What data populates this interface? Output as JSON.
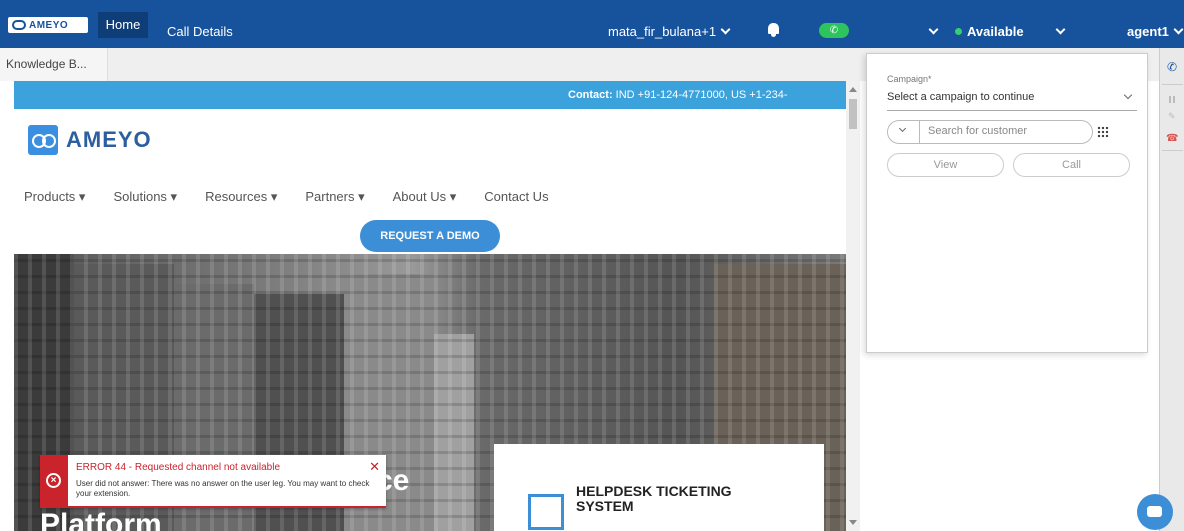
{
  "topbar": {
    "brand": "AMEYO",
    "nav": {
      "home": "Home",
      "call_details": "Call Details"
    },
    "campaign": "mata_fir_bulana+1",
    "status": "Available",
    "agent": "agent1",
    "colors": {
      "bar": "#17529d",
      "available": "#35d06b",
      "phone": "#2ec45d"
    }
  },
  "tabs": {
    "knowledge": "Knowledge B..."
  },
  "website": {
    "contact_label": "Contact:",
    "contact_text": " IND +91-124-4771000, US +1-234-",
    "logo_text": "AMEYO",
    "menu": [
      "Products ▾",
      "Solutions ▾",
      "Resources ▾",
      "Partners ▾",
      "About Us ▾",
      "Contact Us"
    ],
    "demo_button": "REQUEST A DEMO",
    "hero_line1_tail": "ce",
    "hero_line2": "Platform",
    "card_title": "HELPDESK TICKETING SYSTEM"
  },
  "error_toast": {
    "title": "ERROR 44 - Requested channel not available",
    "detail": "User did not answer: There was no answer on the user leg. You may want to check your extension.",
    "close": "✕"
  },
  "dial_panel": {
    "campaign_label": "Campaign*",
    "campaign_select": "Select a campaign to continue",
    "search_placeholder": "Search for customer",
    "view_button": "View",
    "call_button": "Call"
  }
}
